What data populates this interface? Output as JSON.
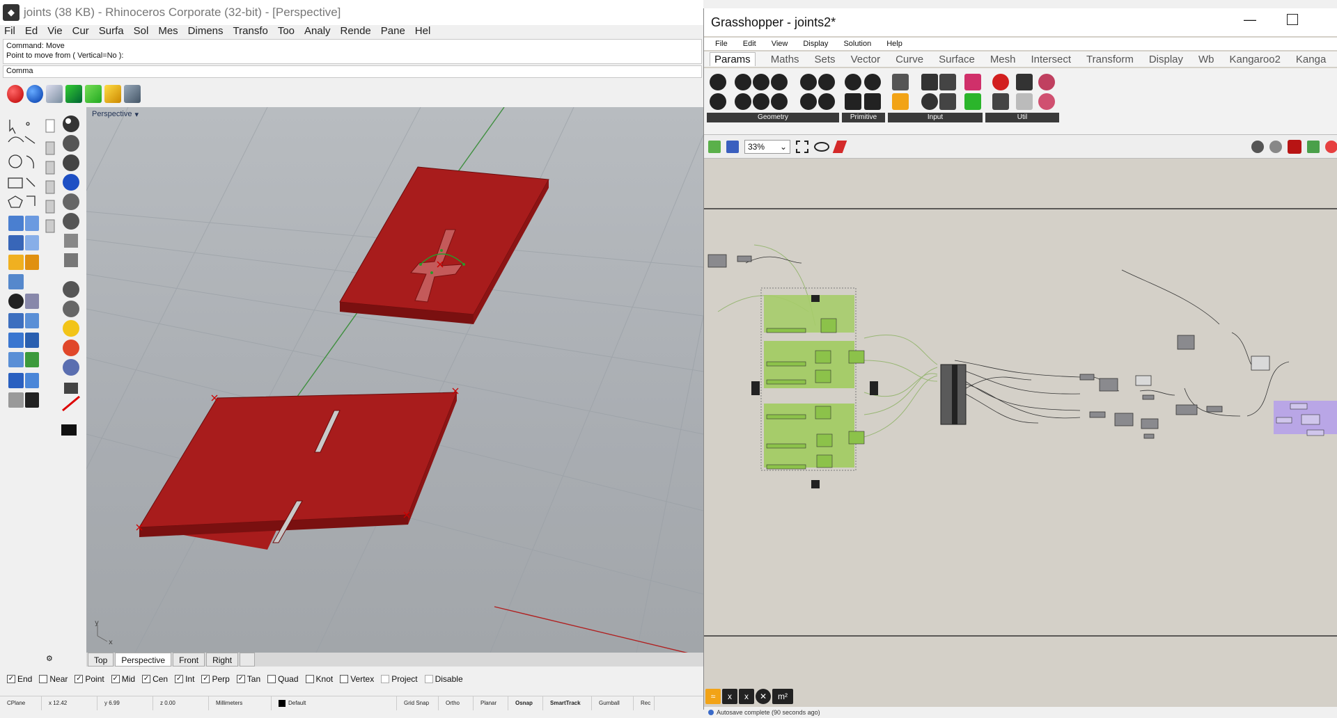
{
  "rhino": {
    "title": "joints (38 KB) - Rhinoceros Corporate (32-bit) - [Perspective]",
    "menu": [
      "Fil",
      "Ed",
      "Vie",
      "Cur",
      "Surfa",
      "Sol",
      "Mes",
      "Dimens",
      "Transfo",
      "Too",
      "Analy",
      "Rende",
      "Pane",
      "Hel"
    ],
    "command_lines": [
      "Command: Move",
      "Point to move from ( Vertical=No ):"
    ],
    "command_input": "Comma",
    "viewport_label": "Perspective",
    "viewport_tabs": [
      "Top",
      "Perspective",
      "Front",
      "Right"
    ],
    "active_tab": "Perspective",
    "axis_y": "y",
    "axis_x": "x",
    "osnaps": [
      {
        "label": "End",
        "checked": true
      },
      {
        "label": "Near",
        "checked": false
      },
      {
        "label": "Point",
        "checked": true
      },
      {
        "label": "Mid",
        "checked": true
      },
      {
        "label": "Cen",
        "checked": true
      },
      {
        "label": "Int",
        "checked": true
      },
      {
        "label": "Perp",
        "checked": true
      },
      {
        "label": "Tan",
        "checked": true
      },
      {
        "label": "Quad",
        "checked": false
      },
      {
        "label": "Knot",
        "checked": false
      },
      {
        "label": "Vertex",
        "checked": false
      },
      {
        "label": "Project",
        "checked": false
      },
      {
        "label": "Disable",
        "checked": false
      }
    ],
    "status": [
      "CPlane",
      "x 12.42",
      "y 6.99",
      "z 0.00",
      "Millimeters",
      "Default",
      "Grid Snap",
      "Ortho",
      "Planar",
      "Osnap",
      "SmartTrack",
      "Gumball",
      "Rec"
    ],
    "colors": {
      "plate": "#a81c1c",
      "plate_edge": "#7a1010",
      "viewport_bg": "#aeb2b6"
    }
  },
  "grasshopper": {
    "title": "Grasshopper - joints2*",
    "menu": [
      "File",
      "Edit",
      "View",
      "Display",
      "Solution",
      "Help"
    ],
    "tabs": [
      "Params",
      "Maths",
      "Sets",
      "Vector",
      "Curve",
      "Surface",
      "Mesh",
      "Intersect",
      "Transform",
      "Display",
      "Wb",
      "Kangaroo2",
      "Kanga"
    ],
    "active_tab": "Params",
    "ribbon_groups": [
      "Geometry",
      "Primitive",
      "Input",
      "Util"
    ],
    "zoom": "33%",
    "status": "Autosave complete (90 seconds ago)",
    "bottom_icons": [
      "x",
      "x",
      "m²"
    ],
    "colors": {
      "canvas": "#d4d0c8",
      "slider_group": "#a6cc6a",
      "param": "#8a8a8e",
      "purple_group": "#b9a6e6"
    }
  }
}
